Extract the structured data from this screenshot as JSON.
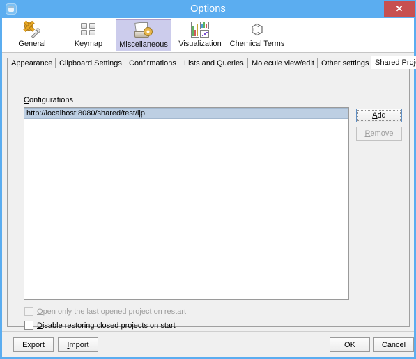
{
  "window": {
    "title": "Options",
    "icon": "window-menu-icon",
    "close_label": "✕",
    "close_color": "#c75050",
    "titlebar_color": "#5badf0"
  },
  "toolbar": {
    "items": [
      {
        "label": "General",
        "icon": "gear-wrench-icon",
        "selected": false
      },
      {
        "label": "Keymap",
        "icon": "keyboard-keys-icon",
        "selected": false
      },
      {
        "label": "Miscellaneous",
        "icon": "papers-gear-icon",
        "selected": true
      },
      {
        "label": "Visualization",
        "icon": "charts-icon",
        "selected": false
      },
      {
        "label": "Chemical Terms",
        "icon": "benzene-ring-icon",
        "selected": false
      }
    ],
    "selected_bg": "#ccccec",
    "selected_border": "#b09cc8"
  },
  "tabs": {
    "items": [
      {
        "label": "Appearance",
        "selected": false
      },
      {
        "label": "Clipboard Settings",
        "selected": false
      },
      {
        "label": "Confirmations",
        "selected": false
      },
      {
        "label": "Lists and Queries",
        "selected": false
      },
      {
        "label": "Molecule view/edit",
        "selected": false
      },
      {
        "label": "Other settings",
        "selected": false
      },
      {
        "label": "Shared Projects",
        "selected": true
      }
    ]
  },
  "panel": {
    "configurations_label_prefix": "C",
    "configurations_label_rest": "onfigurations",
    "list": {
      "rows": [
        {
          "text": "http://localhost:8080/shared/test/ijp",
          "selected": true
        }
      ],
      "selected_bg": "#bdcfe3"
    },
    "side_buttons": [
      {
        "label_prefix": "A",
        "label_rest": "dd",
        "enabled": true,
        "focused": true
      },
      {
        "label_prefix": "R",
        "label_rest": "emove",
        "enabled": false,
        "focused": false
      }
    ],
    "checkboxes": [
      {
        "label_prefix": "O",
        "label_rest": "pen only the last opened project on restart",
        "checked": false,
        "enabled": false
      },
      {
        "label_prefix": "D",
        "label_rest": "isable restoring closed projects on start",
        "checked": false,
        "enabled": true
      }
    ]
  },
  "footer": {
    "export_prefix": "Export",
    "export_rest": "",
    "import_prefix": "I",
    "import_rest": "mport",
    "ok_label": "OK",
    "cancel_label": "Cancel"
  }
}
